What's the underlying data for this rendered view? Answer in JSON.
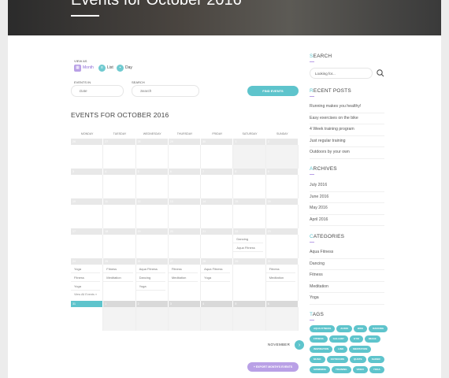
{
  "hero": {
    "title": "Events for October 2016"
  },
  "filters": {
    "view_as_label": "VIEW AS",
    "views": [
      "Month",
      "List",
      "Day"
    ],
    "events_in_label": "EVENTS IN",
    "date_placeholder": "Date",
    "search_label": "SEARCH",
    "search_placeholder": "Search",
    "find_button": "FIND EVENTS"
  },
  "calendar": {
    "title": "EVENTS FOR OCTOBER 2016",
    "days": [
      "MONDAY",
      "TUESDAY",
      "WEDNESDAY",
      "THURSDAY",
      "FRIDAY",
      "SATURDAY",
      "SUNDAY"
    ],
    "weeks": [
      {
        "dates": [
          "26",
          "27",
          "28",
          "29",
          "30",
          "1",
          "2"
        ],
        "events": [
          [],
          [],
          [],
          [],
          [],
          [],
          []
        ]
      },
      {
        "dates": [
          "3",
          "4",
          "5",
          "6",
          "7",
          "8",
          "9"
        ],
        "events": [
          [],
          [],
          [],
          [],
          [],
          [],
          []
        ]
      },
      {
        "dates": [
          "10",
          "11",
          "12",
          "13",
          "14",
          "15",
          "16"
        ],
        "events": [
          [],
          [],
          [],
          [],
          [],
          [],
          []
        ]
      },
      {
        "dates": [
          "17",
          "18",
          "19",
          "20",
          "21",
          "22",
          "23"
        ],
        "events": [
          [],
          [],
          [],
          [],
          [],
          [
            "Dancing",
            "Aqua Fitness"
          ],
          []
        ]
      },
      {
        "dates": [
          "24",
          "25",
          "26",
          "27",
          "28",
          "29",
          "30"
        ],
        "events": [
          [
            "Yoga",
            "Fitness",
            "Yoga"
          ],
          [
            "Fitness",
            "Meditation"
          ],
          [
            "Aqua Fitness",
            "Dancing",
            "Yoga"
          ],
          [
            "Fitness",
            "Meditation"
          ],
          [
            "Aqua Fitness",
            "Yoga"
          ],
          [],
          [
            "Fitness",
            "Meditation"
          ]
        ],
        "view_all": "View All Events »"
      },
      {
        "dates": [
          "31",
          "1",
          "2",
          "3",
          "4",
          "5",
          "6"
        ],
        "events": [
          [],
          [],
          [],
          [],
          [],
          [],
          []
        ]
      }
    ],
    "next_month": "NOVEMBER",
    "export_button": "+ EXPORT MONTH'S EVENTS"
  },
  "sidebar": {
    "search_title": "SEARCH",
    "search_placeholder": "Looking for...",
    "recent_title": "RECENT POSTS",
    "recent_posts": [
      "Running makes you healthy!",
      "Easy exercises on the bike",
      "4 Week training program",
      "Just regular training",
      "Outdoors by your own"
    ],
    "archives_title": "ARCHIVES",
    "archives": [
      "July 2016",
      "June 2016",
      "May 2016",
      "April 2016"
    ],
    "categories_title": "CATEGORIES",
    "categories": [
      "Aqua Fitness",
      "Dancing",
      "Fitness",
      "Meditation",
      "Yoga"
    ],
    "tags_title": "TAGS",
    "tags": [
      "AQUA FITNESS",
      "AUDIO",
      "BIKE",
      "DANCING",
      "FITNESS",
      "GALLERY",
      "GYM",
      "IMAGE",
      "INSPIRATION",
      "LINK",
      "MEDITATION",
      "MUSIC",
      "OUTDOORS",
      "QUOTE",
      "SLIDER",
      "SWIMMING",
      "TRAINING",
      "VIDEO",
      "YOGA"
    ]
  },
  "colors": {
    "accent": "#5ec4cc",
    "secondary": "#b9a0e6"
  }
}
